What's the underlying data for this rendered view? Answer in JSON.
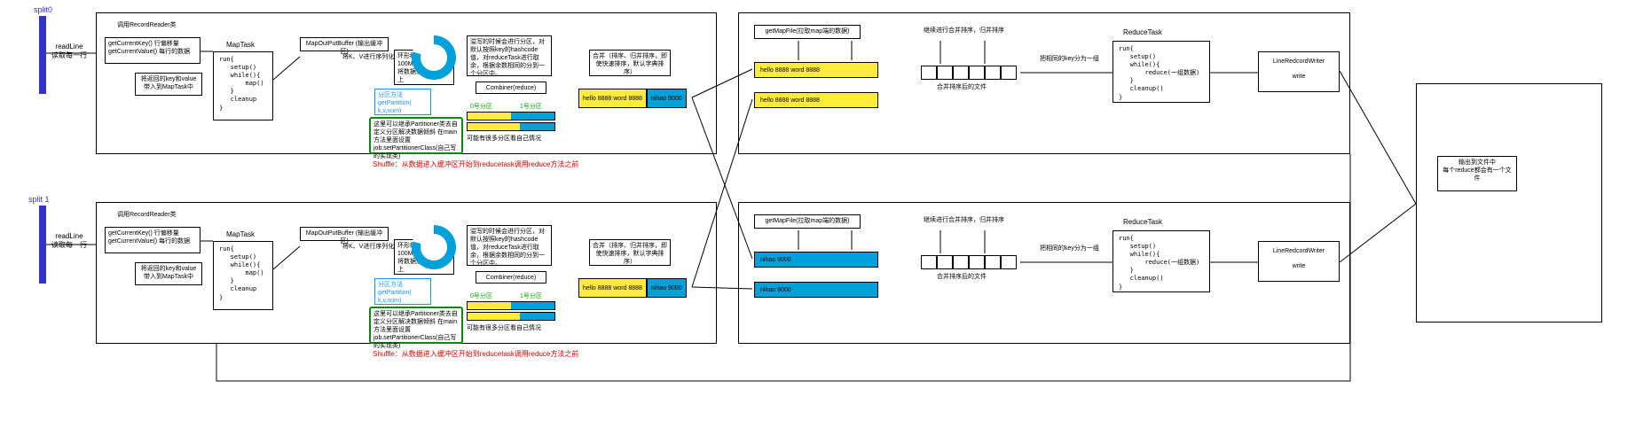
{
  "splits": [
    {
      "label": "split0"
    },
    {
      "label": "split 1"
    }
  ],
  "readline": {
    "l1": "readLine",
    "l2": "读取每一行"
  },
  "record_reader": {
    "title": "调用RecordReader类",
    "l1": "getCurrentKey() 行偏移量",
    "l2": "getCurrentValue() 每行的数据",
    "note": "将返回的key和value带入到MapTask中"
  },
  "maptask": {
    "title": "MapTask",
    "code": "run{\n   setup()\n   while(){\n       map()\n   }\n   cleanup\n}"
  },
  "buffer": {
    "title": "MapOutPutBuffer (输出缓冲区)",
    "serialize": "将K、V进行序列化",
    "ring_note": "环形缓冲区，默认100M，达到80%，将数据溢写到磁盘上",
    "partition_call": "分区方法\ngetPartition(\n    k,v,num)",
    "partitioner": "这里可以继承Partitioner类去自定义分区解决数据倾斜\n在main方法里面设置\njob.setPartitionerClass(自己写的实现类)",
    "partition_desc": "溢写的时候会进行分区，对默认按照key的hashcode值，对reduceTask进行取余，根据余数相同的分到一个分区中。",
    "combiner": "Combiner(reduce)",
    "p0": "0号分区",
    "p1": "1号分区",
    "multi_part_note": "可能有很多分区看自己情况"
  },
  "merge_sort": {
    "title": "合并（排序、归并排序，即使快速排序，默认字典排序）",
    "rows_a": [
      "hello 8888  word 8888",
      "nihao 9000"
    ],
    "rows_b": [
      "hello 8888  word 8888",
      "nihao 9000"
    ]
  },
  "shuffle_note": "Shuffle：从数据进入缓冲区开始到reducetask调用reduce方法之前",
  "reduce_side": {
    "getmap": "getMapFile(拉取map端的数据)",
    "merge": "继续进行合并排序，归并排序",
    "merged_file": "合并排序后的文件",
    "group": "把相同的key分为一组",
    "reduce_title": "ReduceTask",
    "reduce_code": "run{\n   setup()\n   while(){\n       reduce(一组数据)\n   }\n   cleanup()\n}",
    "writer": "LineRedcordWriter",
    "write": "write",
    "data_top": [
      "hello 8888  word 8888",
      "hello 8888  word 8888"
    ],
    "data_bottom": [
      "nihao 9000",
      "nihao 9000"
    ]
  },
  "output": {
    "l1": "输出到文件中",
    "l2": "每个reduce都会有一个文件"
  }
}
